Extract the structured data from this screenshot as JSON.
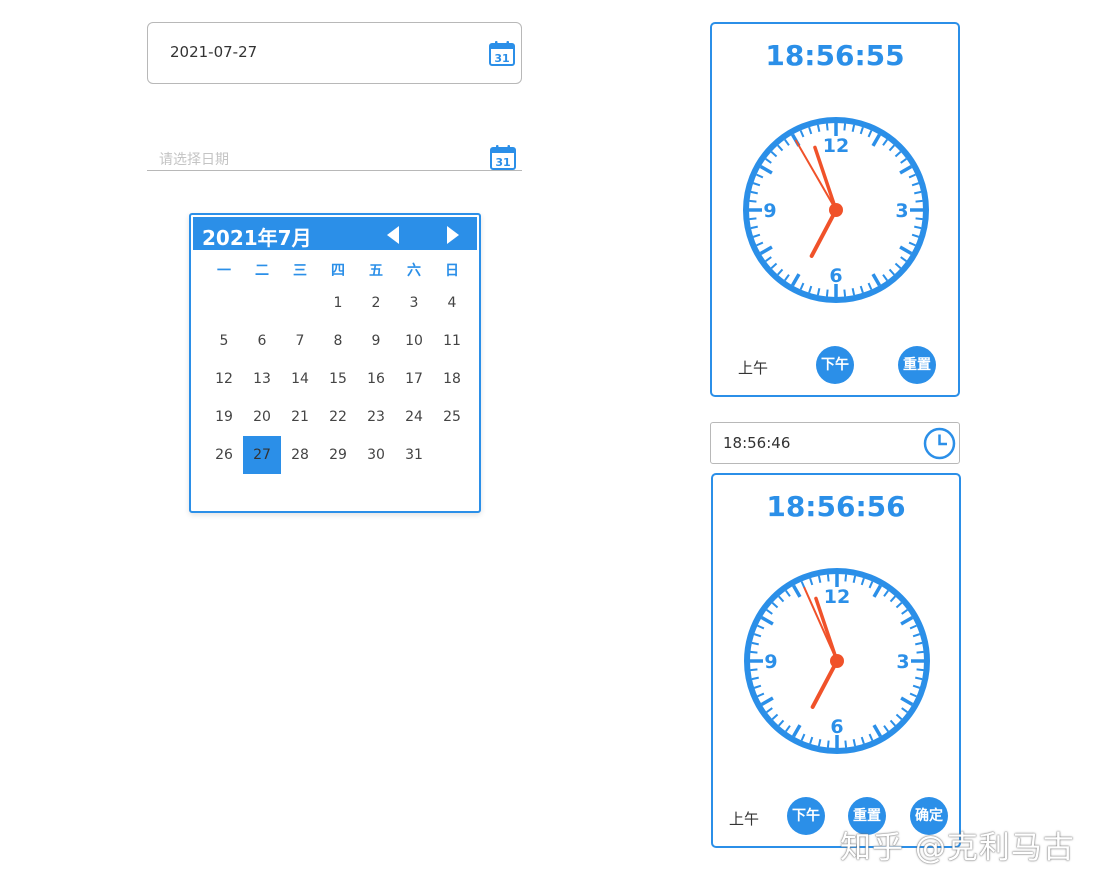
{
  "date_input": {
    "value": "2021-07-27",
    "icon": "calendar-icon",
    "icon_number": "31"
  },
  "date_input_empty": {
    "placeholder": "请选择日期",
    "icon": "calendar-icon",
    "icon_number": "31"
  },
  "calendar": {
    "title": "2021年7月",
    "weekdays": [
      "一",
      "二",
      "三",
      "四",
      "五",
      "六",
      "日"
    ],
    "weeks": [
      [
        "",
        "",
        "",
        "1",
        "2",
        "3",
        "4"
      ],
      [
        "5",
        "6",
        "7",
        "8",
        "9",
        "10",
        "11"
      ],
      [
        "12",
        "13",
        "14",
        "15",
        "16",
        "17",
        "18"
      ],
      [
        "19",
        "20",
        "21",
        "22",
        "23",
        "24",
        "25"
      ],
      [
        "26",
        "27",
        "28",
        "29",
        "30",
        "31",
        ""
      ]
    ],
    "selected": "27",
    "prev_icon": "triangle-left-icon",
    "next_icon": "triangle-right-icon"
  },
  "clock1": {
    "time": "18:56:55",
    "numbers": [
      "12",
      "3",
      "6",
      "9"
    ],
    "hands": {
      "hour": 6.93,
      "minute": 56.9,
      "second": 55
    },
    "am_label": "上午",
    "pm_label": "下午",
    "reset_label": "重置"
  },
  "time_input": {
    "value": "18:56:46",
    "icon": "clock-icon"
  },
  "clock2": {
    "time": "18:56:56",
    "numbers": [
      "12",
      "3",
      "6",
      "9"
    ],
    "hands": {
      "hour": 6.93,
      "minute": 56.9,
      "second": 56
    },
    "am_label": "上午",
    "pm_label": "下午",
    "reset_label": "重置",
    "confirm_label": "确定"
  },
  "watermark": "知乎 @克利马古",
  "colors": {
    "accent": "#2b8fe8",
    "hand": "#f0522a",
    "border": "#b8b8b8"
  }
}
